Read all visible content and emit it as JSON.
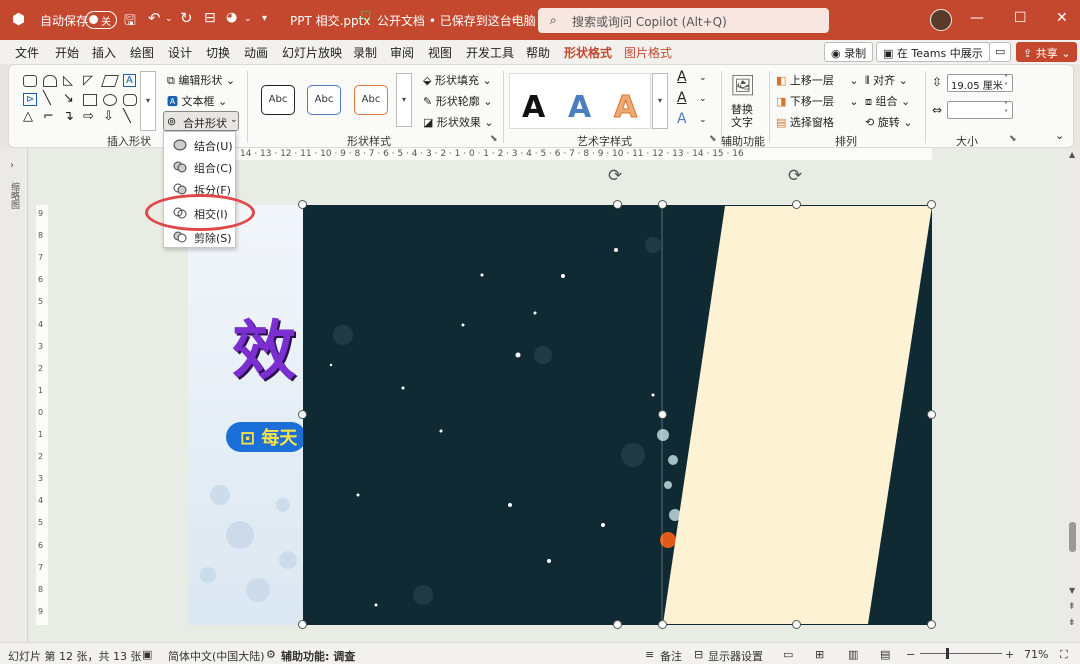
{
  "titlebar": {
    "autosave_label": "自动保存",
    "autosave_state": "关",
    "filename": "PPT 相交.pptx",
    "doc_status": "公开文档 • 已保存到这台电脑",
    "search_placeholder": "搜索或询问 Copilot (Alt+Q)"
  },
  "tabs": [
    {
      "label": "文件"
    },
    {
      "label": "开始"
    },
    {
      "label": "插入"
    },
    {
      "label": "绘图"
    },
    {
      "label": "设计"
    },
    {
      "label": "切换"
    },
    {
      "label": "动画"
    },
    {
      "label": "幻灯片放映"
    },
    {
      "label": "录制"
    },
    {
      "label": "审阅"
    },
    {
      "label": "视图"
    },
    {
      "label": "开发工具"
    },
    {
      "label": "帮助"
    },
    {
      "label": "形状格式"
    },
    {
      "label": "图片格式"
    }
  ],
  "tab_buttons": {
    "record": "录制",
    "teams": "在 Teams 中展示",
    "share": "共享"
  },
  "ribbon": {
    "insert_shapes": {
      "title": "插入形状",
      "edit_shape": "编辑形状",
      "text_box": "文本框",
      "merge_shapes": "合并形状"
    },
    "shape_styles": {
      "title": "形状样式",
      "sample": "Abc",
      "fill": "形状填充",
      "outline": "形状轮廓",
      "effects": "形状效果"
    },
    "wordart": {
      "title": "艺术字样式",
      "letter": "A"
    },
    "accessibility": {
      "title": "辅助功能",
      "alt_text_line1": "替换",
      "alt_text_line2": "文字"
    },
    "arrange": {
      "title": "排列",
      "bring_forward": "上移一层",
      "send_backward": "下移一层",
      "selection_pane": "选择窗格",
      "align": "对齐",
      "group": "组合",
      "rotate": "旋转"
    },
    "size": {
      "title": "大小",
      "width_value": "19.05 厘米",
      "height_value": ""
    }
  },
  "merge_menu": [
    {
      "label": "结合(U)"
    },
    {
      "label": "组合(C)"
    },
    {
      "label": "拆分(F)"
    },
    {
      "label": "相交(I)"
    },
    {
      "label": "剪除(S)"
    }
  ],
  "left_pane_label": "缩略图",
  "ruler_h": "14 · 13 · 12 · 11 · 10 · 9 · 8 · 7 · 6 · 5 · 4 · 3 · 2 · 1 · 0 · 1 · 2 · 3 · 4 · 5 · 6 · 7 · 8 · 9 · 10 · 11 · 12 · 13 · 14 · 15 · 16",
  "ruler_v": [
    "9",
    "8",
    "7",
    "6",
    "5",
    "4",
    "3",
    "2",
    "1",
    "0",
    "1",
    "2",
    "3",
    "4",
    "5",
    "6",
    "7",
    "8",
    "9"
  ],
  "slide": {
    "title_fragment": "效",
    "banner_fragment": "每天"
  },
  "status": {
    "slide_info": "幻灯片 第 12 张，共 13 张",
    "language": "简体中文(中国大陆)",
    "accessibility": "辅助功能: 调查",
    "notes": "备注",
    "display_settings": "显示器设置",
    "zoom": "71%"
  },
  "colors": {
    "title_bar": "#c4482e",
    "accent": "#c4482e",
    "highlight_circle": "#e04748",
    "photo_bg": "#0f2630",
    "shape_fill": "#fdf2d3"
  }
}
